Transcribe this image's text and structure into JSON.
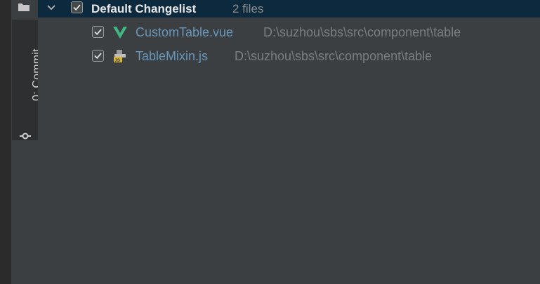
{
  "sidebar": {
    "tab_label": "0: Commit",
    "tab_shortcut": "0",
    "tab_name": ": Commit"
  },
  "changelist": {
    "title": "Default Changelist",
    "count_label": "2 files",
    "checked": true,
    "expanded": true,
    "files": [
      {
        "name": "CustomTable.vue",
        "path": "D:\\suzhou\\sbs\\src\\component\\table",
        "icon": "vue-file-icon",
        "checked": true
      },
      {
        "name": "TableMixin.js",
        "path": "D:\\suzhou\\sbs\\src\\component\\table",
        "icon": "js-file-icon",
        "checked": true
      }
    ]
  },
  "colors": {
    "background": "#3c3f41",
    "header_selected": "#0d293e",
    "file_name": "#6897bb",
    "path": "#7a7e80",
    "vue_green": "#41b883",
    "js_yellow": "#d6b33c"
  }
}
